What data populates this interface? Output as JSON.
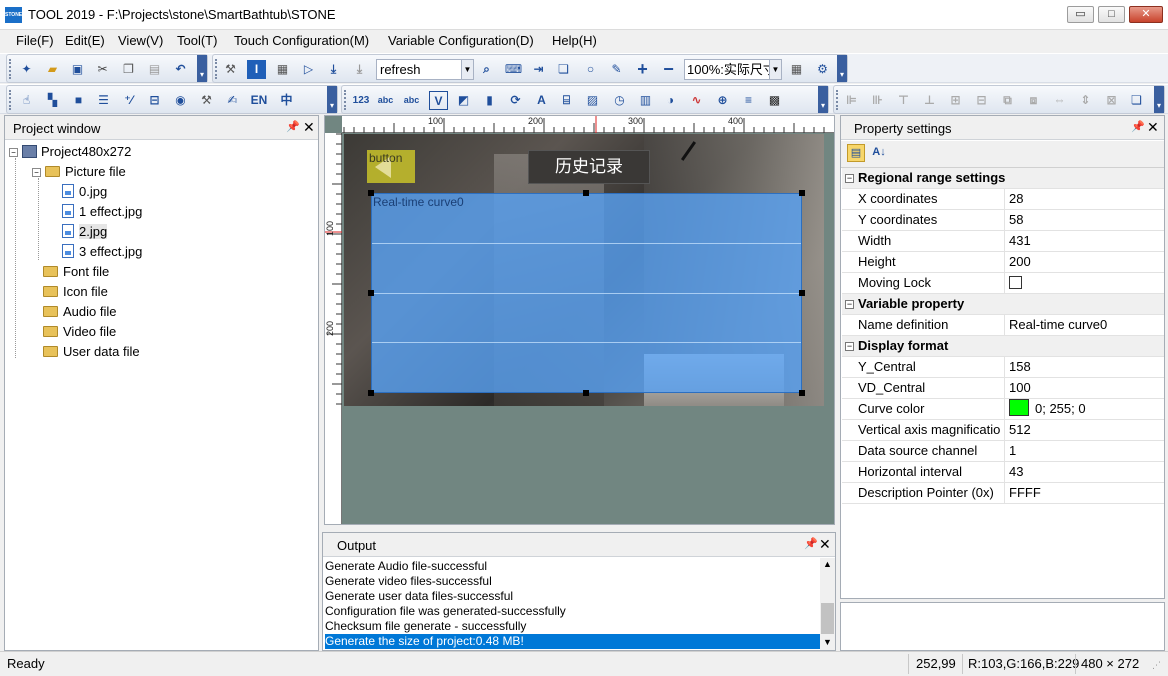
{
  "window": {
    "title": "TOOL 2019 - F:\\Projects\\stone\\SmartBathtub\\STONE",
    "app_icon_text": "STONE",
    "minimize": "▭",
    "maximize": "□",
    "close": "✕"
  },
  "menu": [
    {
      "label": "File(F)"
    },
    {
      "label": "Edit(E)"
    },
    {
      "label": "View(V)"
    },
    {
      "label": "Tool(T)"
    },
    {
      "label": "Touch Configuration(M)"
    },
    {
      "label": "Variable Configuration(D)"
    },
    {
      "label": "Help(H)"
    }
  ],
  "toolbar": {
    "refresh_value": "refresh",
    "zoom_value": "100%:实际尺寸",
    "lang_en": "EN",
    "lang_zh": "中",
    "icon_123": "123",
    "icon_abc": "abc",
    "icon_v": "V"
  },
  "project_window": {
    "title": "Project window",
    "root": "Project480x272",
    "picture_folder": "Picture file",
    "pictures": [
      "0.jpg",
      "1 effect.jpg",
      "2.jpg",
      "3 effect.jpg"
    ],
    "folders": [
      "Font file",
      "Icon file",
      "Audio file",
      "Video file",
      "User data file"
    ]
  },
  "canvas": {
    "ruler_h_labels": [
      "100",
      "200",
      "300",
      "400"
    ],
    "ruler_v_labels": [
      "100",
      "200"
    ],
    "back_button_text": "button",
    "screen_title": "历史记录",
    "curve_label": "Real-time curve0"
  },
  "output": {
    "title": "Output",
    "lines": [
      "Generate Audio file-successful",
      "Generate video files-successful",
      "Generate user data files-successful",
      "Configuration file was generated-successfully",
      "Checksum file generate - successfully",
      "Generate the size of project:0.48 MB!"
    ]
  },
  "properties": {
    "title": "Property settings",
    "categories": [
      {
        "name": "Regional range settings",
        "rows": [
          {
            "k": "X coordinates",
            "v": "28"
          },
          {
            "k": "Y coordinates",
            "v": "58"
          },
          {
            "k": "Width",
            "v": "431"
          },
          {
            "k": "Height",
            "v": "200"
          },
          {
            "k": "Moving Lock",
            "v": ""
          }
        ]
      },
      {
        "name": "Variable property",
        "rows": [
          {
            "k": "Name definition",
            "v": "Real-time curve0"
          }
        ]
      },
      {
        "name": "Display format",
        "rows": [
          {
            "k": "Y_Central",
            "v": "158"
          },
          {
            "k": "VD_Central",
            "v": "100"
          },
          {
            "k": "Curve color",
            "v": "0; 255; 0"
          },
          {
            "k": "Vertical axis magnificatio",
            "v": "512"
          },
          {
            "k": "Data source channel",
            "v": "1"
          },
          {
            "k": "Horizontal interval",
            "v": "43"
          },
          {
            "k": "Description Pointer (0x)",
            "v": "FFFF"
          }
        ]
      }
    ],
    "curve_color_hex": "#00ff00"
  },
  "status": {
    "ready": "Ready",
    "coords": "252,99",
    "rgb": "R:103,G:166,B:229",
    "size": "480 × 272"
  }
}
